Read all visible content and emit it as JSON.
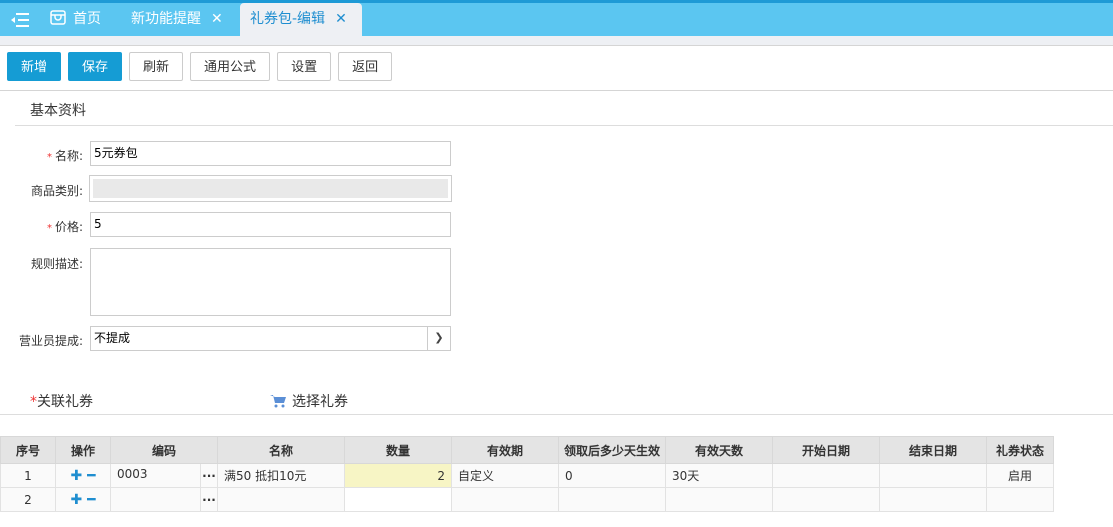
{
  "tabs": [
    {
      "label": "首页"
    },
    {
      "label": "新功能提醒",
      "close": "✕"
    },
    {
      "label": "礼券包-编辑",
      "close": "✕"
    }
  ],
  "toolbar": {
    "new": "新增",
    "save": "保存",
    "refresh": "刷新",
    "formula": "通用公式",
    "settings": "设置",
    "back": "返回"
  },
  "section": {
    "title": "基本资料"
  },
  "form": {
    "name": {
      "label": "名称:",
      "value": "5元券包",
      "required": "*"
    },
    "category": {
      "label": "商品类别:",
      "value": ""
    },
    "price": {
      "label": "价格:",
      "value": "5",
      "required": "*"
    },
    "rules": {
      "label": "规则描述:",
      "value": ""
    },
    "commission": {
      "label": "营业员提成:",
      "value": "不提成"
    }
  },
  "coupons": {
    "required": "*",
    "title": "关联礼券",
    "select_label": "选择礼券",
    "columns": [
      "序号",
      "操作",
      "编码",
      "名称",
      "数量",
      "有效期",
      "领取后多少天生效",
      "有效天数",
      "开始日期",
      "结束日期",
      "礼券状态"
    ],
    "rows": [
      {
        "no": "1",
        "code": "0003",
        "name": "满50 抵扣10元",
        "qty": "2",
        "validity": "自定义",
        "delay": "0",
        "days": "30天",
        "start": "",
        "end": "",
        "status": "启用"
      },
      {
        "no": "2",
        "code": "",
        "name": "",
        "qty": "",
        "validity": "",
        "delay": "",
        "days": "",
        "start": "",
        "end": "",
        "status": ""
      }
    ]
  }
}
